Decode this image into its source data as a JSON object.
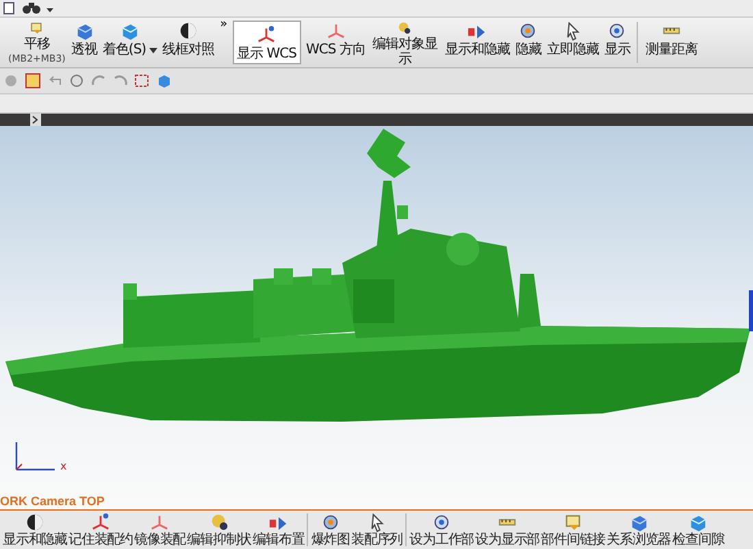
{
  "ribbon": {
    "items": [
      {
        "label": "平移",
        "sublabel": "(MB2+MB3)",
        "selected": false,
        "dropdown": false
      },
      {
        "label": "透视",
        "selected": false,
        "dropdown": false
      },
      {
        "label": "着色(S)",
        "selected": false,
        "dropdown": true
      },
      {
        "label": "线框对照",
        "selected": false,
        "dropdown": false
      },
      {
        "label": "显示 WCS",
        "selected": true,
        "dropdown": false
      },
      {
        "label": "WCS 方向",
        "selected": false,
        "dropdown": false
      },
      {
        "label": "编辑对象显示",
        "selected": false,
        "dropdown": false
      },
      {
        "label": "显示和隐藏",
        "selected": false,
        "dropdown": false
      },
      {
        "label": "隐藏",
        "selected": false,
        "dropdown": false
      },
      {
        "label": "立即隐藏",
        "selected": false,
        "dropdown": false
      },
      {
        "label": "显示",
        "selected": false,
        "dropdown": false
      },
      {
        "label": "测量距离",
        "selected": false,
        "dropdown": false
      }
    ],
    "overflow": "»"
  },
  "viewport": {
    "camera_label": "ORK Camera TOP",
    "axis_label": "x"
  },
  "bottom_toolbar": {
    "items": [
      {
        "label": "显示和隐藏"
      },
      {
        "label": "记住装配约"
      },
      {
        "label": "镜像装配"
      },
      {
        "label": "编辑抑制状"
      },
      {
        "label": "编辑布置"
      },
      {
        "label": "爆炸图"
      },
      {
        "label": "装配序列"
      },
      {
        "label": "设为工作部"
      },
      {
        "label": "设为显示部"
      },
      {
        "label": "部件间链接"
      },
      {
        "label": "关系浏览器"
      },
      {
        "label": "检查间隙"
      }
    ]
  }
}
